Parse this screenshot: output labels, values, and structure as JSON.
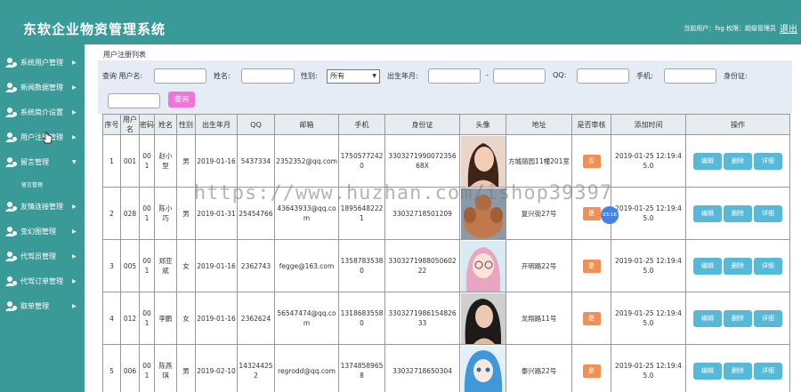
{
  "header": {
    "title": "东软企业物资管理系统",
    "user_info": "当前用户：fsg  权限：超级管理员",
    "logout": "退出"
  },
  "sidebar": {
    "items": [
      {
        "label": "系统用户管理"
      },
      {
        "label": "新闻数据管理"
      },
      {
        "label": "系统简介设置"
      },
      {
        "label": "用户注册管理"
      },
      {
        "label": "留言管理",
        "expanded": true,
        "sub": "留言管理"
      },
      {
        "label": "友情连接管理"
      },
      {
        "label": "变幻图管理"
      },
      {
        "label": "代驾员管理"
      },
      {
        "label": "代驾订单管理"
      },
      {
        "label": "取单管理"
      }
    ]
  },
  "panel_title": "用户注册列表",
  "filter": {
    "query_label": "查询 用户名:",
    "name_label": "姓名:",
    "gender_label": "性别:",
    "gender_value": "所有",
    "birth_label": "出生年月:",
    "dash": "-",
    "qq_label": "QQ:",
    "phone_label": "手机:",
    "idcard_label": "身份证:",
    "query_button": "查询"
  },
  "table": {
    "headers": [
      "序号",
      "用户名",
      "密码",
      "姓名",
      "性别",
      "出生年月",
      "QQ",
      "邮箱",
      "手机",
      "身份证",
      "头像",
      "地址",
      "是否审核",
      "添加时间",
      "操作"
    ],
    "rows": [
      {
        "no": "1",
        "username": "001",
        "password": "001",
        "name": "赵小型",
        "gender": "男",
        "birth": "2019-01-16",
        "qq": "5437334",
        "email": "2352352@qq.com",
        "phone": "17505772420",
        "idcard": "330327199007235668X",
        "address": "方城丽园11幢201室",
        "status": "否",
        "added": "2019-01-25 12:19:45.0",
        "avatar": "woman-portrait"
      },
      {
        "no": "2",
        "username": "028",
        "password": "001",
        "name": "陈小巧",
        "gender": "男",
        "birth": "2019-01-31",
        "qq": "25454766",
        "email": "43643933@qq.com",
        "phone": "18956482221",
        "idcard": "33032718501209",
        "address": "复兴街27号",
        "status": "是",
        "added": "2019-01-25 12:19:45.0",
        "avatar": "muscle-man"
      },
      {
        "no": "3",
        "username": "005",
        "password": "001",
        "name": "郑亚斌",
        "gender": "女",
        "birth": "2019-01-16",
        "qq": "2362743",
        "email": "fegge@163.com",
        "phone": "13587835380",
        "idcard": "330327198805060222",
        "address": "开明路22号",
        "status": "是",
        "added": "2019-01-25 12:19:45.0",
        "avatar": "anime-girl-glasses"
      },
      {
        "no": "4",
        "username": "012",
        "password": "001",
        "name": "李鹏",
        "gender": "女",
        "birth": "2019-01-16",
        "qq": "2362624",
        "email": "56547474@qq.com",
        "phone": "13186835580",
        "idcard": "330327198615482633",
        "address": "龙翔路11号",
        "status": "是",
        "added": "2019-01-25 12:19:45.0",
        "avatar": "woman-dark-hair"
      },
      {
        "no": "5",
        "username": "006",
        "password": "001",
        "name": "陈燕琪",
        "gender": "男",
        "birth": "2019-02-10",
        "qq": "143244252",
        "email": "regrodd@qq.com",
        "phone": "13748589658",
        "idcard": "33032718650304",
        "address": "泰兴路22号",
        "status": "是",
        "added": "2019-01-25 12:19:45.0",
        "avatar": "anime-blue-hair"
      }
    ],
    "actions": {
      "edit": "编辑",
      "delete": "删除",
      "detail": "详细"
    }
  },
  "watermark": "https://www.huzhan.com/ishop39397",
  "timer": "03:16",
  "colors": {
    "teal": "#3a9a98",
    "action_blue": "#56b9d8",
    "status_orange": "#f29054",
    "query_pink": "#f075d8"
  }
}
